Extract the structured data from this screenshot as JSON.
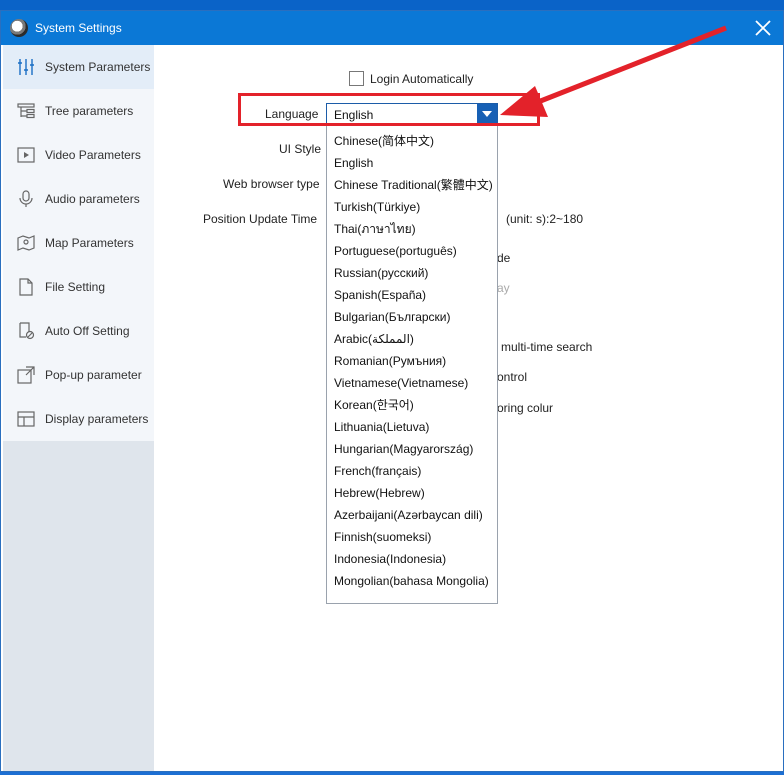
{
  "window": {
    "title": "System Settings",
    "close_label": "Close"
  },
  "sidebar": {
    "items": [
      {
        "label": "System Parameters"
      },
      {
        "label": "Tree parameters"
      },
      {
        "label": "Video Parameters"
      },
      {
        "label": "Audio parameters"
      },
      {
        "label": "Map Parameters"
      },
      {
        "label": "File Setting"
      },
      {
        "label": "Auto Off Setting"
      },
      {
        "label": "Pop-up parameter"
      },
      {
        "label": "Display parameters"
      }
    ]
  },
  "settings": {
    "login_auto_label": "Login Automatically",
    "language_label": "Language",
    "language_value": "English",
    "ui_style_label": "UI Style",
    "web_browser_label": "Web browser type",
    "position_update_label": "Position Update Time",
    "position_update_unit": "(unit: s):2~180",
    "partial_1": "de",
    "partial_2": "ay",
    "partial_3": "multi-time search",
    "partial_4": "ontrol",
    "partial_5": "oring colur"
  },
  "language_options": [
    "Chinese(简体中文)",
    "English",
    "Chinese Traditional(繁體中文)",
    "Turkish(Türkiye)",
    "Thai(ภาษาไทย)",
    "Portuguese(português)",
    "Russian(русский)",
    "Spanish(España)",
    "Bulgarian(Български)",
    "Arabic(المملكة)",
    "Romanian(Румъния)",
    "Vietnamese(Vietnamese)",
    "Korean(한국어)",
    "Lithuania(Lietuva)",
    "Hungarian(Magyarország)",
    "French(français)",
    "Hebrew(Hebrew)",
    "Azerbaijani(Azərbaycan dili)",
    "Finnish(suomeksi)",
    "Indonesia(Indonesia)",
    "Mongolian(bahasa Mongolia)"
  ],
  "colors": {
    "titlebar": "#0b78d6",
    "accent": "#1760b5",
    "annotation": "#e3222a"
  }
}
